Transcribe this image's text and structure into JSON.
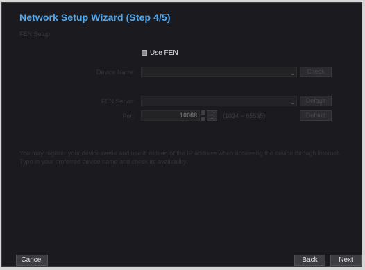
{
  "title": "Network Setup Wizard (Step 4/5)",
  "subtitle": "FEN Setup",
  "use_fen": {
    "label": "Use FEN",
    "checked": true
  },
  "device_name": {
    "label": "Device Name",
    "value": "",
    "check_button": "Check"
  },
  "fen_server": {
    "label": "FEN Server",
    "value": "",
    "default_button": "Default"
  },
  "port": {
    "label": "Port",
    "value": "10088",
    "range": "(1024 ~ 65535)",
    "default_button": "Default"
  },
  "info_text": "You may register your device name and use it instead of the IP address when accessing the device through internet. Type in your preferred device name and check its availability.",
  "buttons": {
    "cancel": "Cancel",
    "back": "Back",
    "next": "Next"
  },
  "colors": {
    "title": "#4fa8f0",
    "background": "#1b1b1f"
  }
}
